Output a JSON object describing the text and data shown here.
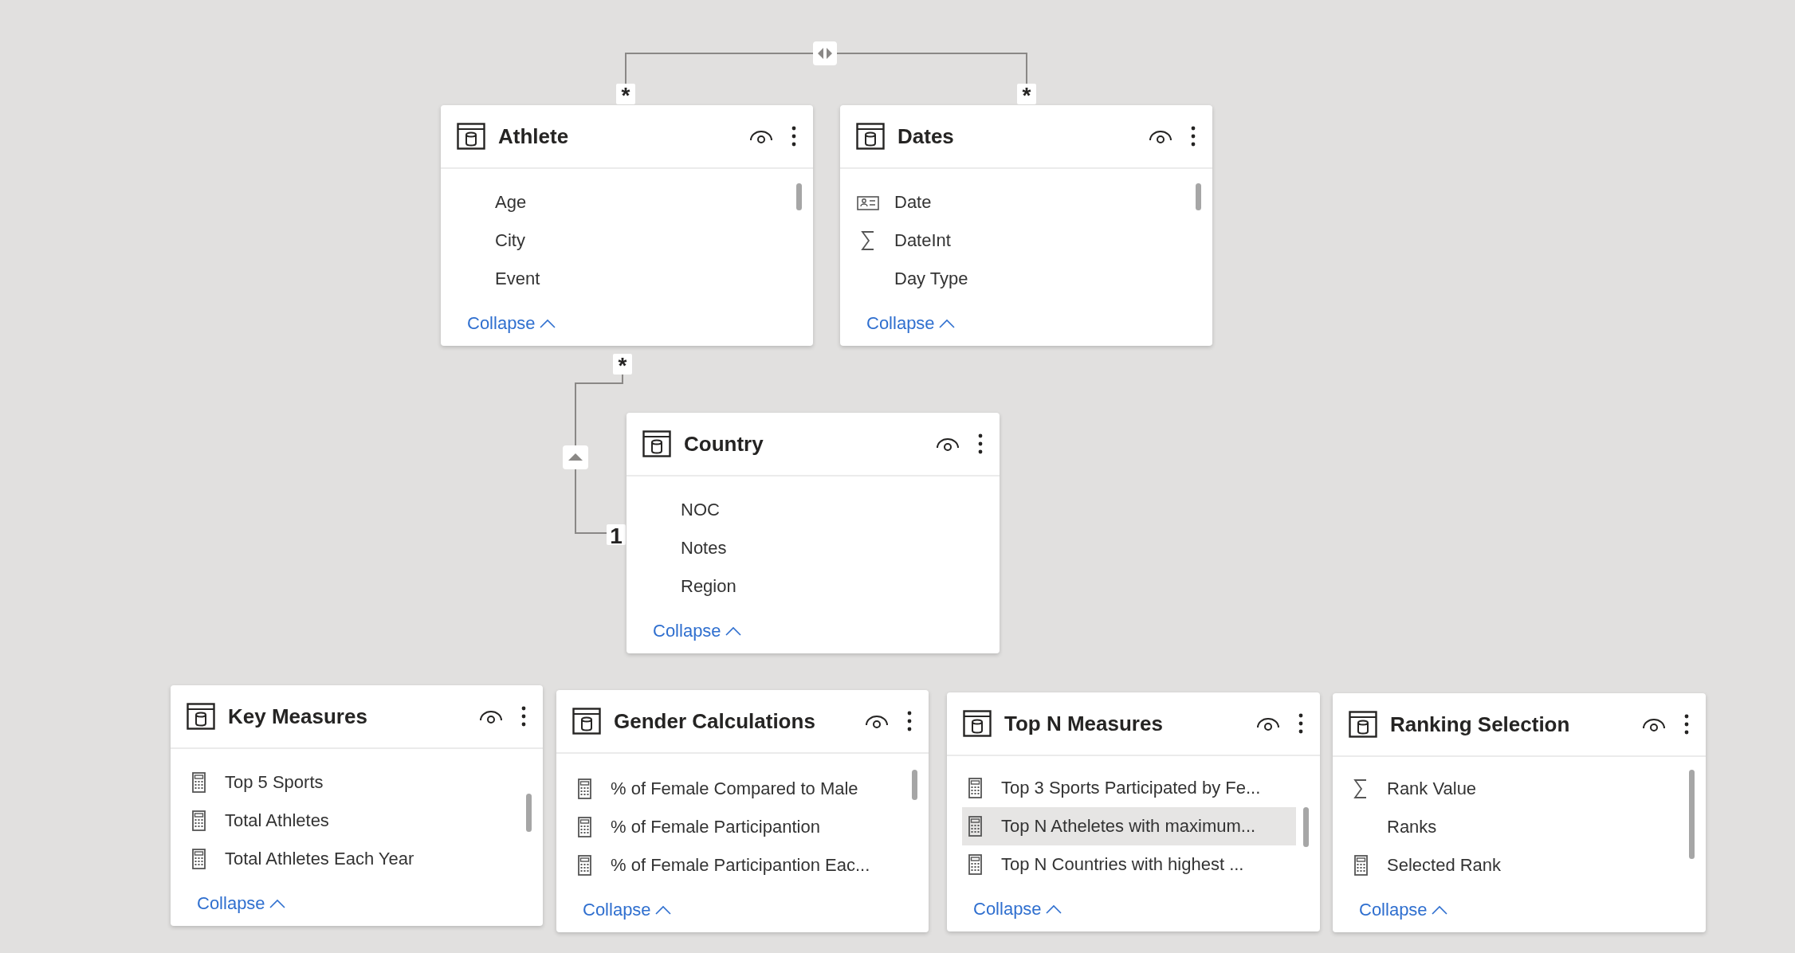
{
  "relationships": [
    {
      "from_label": "*",
      "to_label": "*",
      "kind": "bidirectional"
    },
    {
      "from_label": "*",
      "to_label": "1",
      "kind": "single"
    }
  ],
  "tables": [
    {
      "name": "Athlete",
      "collapse": "Collapse",
      "fields": [
        {
          "name": "Age",
          "kind": "plain",
          "selected": false
        },
        {
          "name": "City",
          "kind": "plain",
          "selected": false
        },
        {
          "name": "Event",
          "kind": "plain",
          "selected": false
        }
      ]
    },
    {
      "name": "Dates",
      "collapse": "Collapse",
      "fields": [
        {
          "name": "Date",
          "kind": "date",
          "selected": false
        },
        {
          "name": "DateInt",
          "kind": "sum",
          "selected": false
        },
        {
          "name": "Day Type",
          "kind": "plain",
          "selected": false
        }
      ]
    },
    {
      "name": "Country",
      "collapse": "Collapse",
      "fields": [
        {
          "name": "NOC",
          "kind": "plain",
          "selected": false
        },
        {
          "name": "Notes",
          "kind": "plain",
          "selected": false
        },
        {
          "name": "Region",
          "kind": "plain",
          "selected": false
        }
      ]
    },
    {
      "name": "Key Measures",
      "collapse": "Collapse",
      "fields": [
        {
          "name": "Top 5 Sports",
          "kind": "measure",
          "selected": false
        },
        {
          "name": "Total Athletes",
          "kind": "measure",
          "selected": false
        },
        {
          "name": "Total Athletes Each Year",
          "kind": "measure",
          "selected": false
        }
      ]
    },
    {
      "name": "Gender Calculations",
      "collapse": "Collapse",
      "fields": [
        {
          "name": "% of Female Compared to Male",
          "kind": "measure",
          "selected": false
        },
        {
          "name": "% of Female Participantion",
          "kind": "measure",
          "selected": false
        },
        {
          "name": "% of Female Participantion Eac...",
          "kind": "measure",
          "selected": false
        }
      ]
    },
    {
      "name": "Top N Measures",
      "collapse": "Collapse",
      "fields": [
        {
          "name": "Top 3 Sports Participated by Fe...",
          "kind": "measure",
          "selected": false
        },
        {
          "name": "Top N Atheletes with maximum...",
          "kind": "measure",
          "selected": true
        },
        {
          "name": "Top N Countries with highest ...",
          "kind": "measure",
          "selected": false
        }
      ]
    },
    {
      "name": "Ranking Selection",
      "collapse": "Collapse",
      "fields": [
        {
          "name": "Rank Value",
          "kind": "sum",
          "selected": false
        },
        {
          "name": "Ranks",
          "kind": "plain",
          "selected": false
        },
        {
          "name": "Selected Rank",
          "kind": "measure",
          "selected": false
        }
      ]
    }
  ]
}
